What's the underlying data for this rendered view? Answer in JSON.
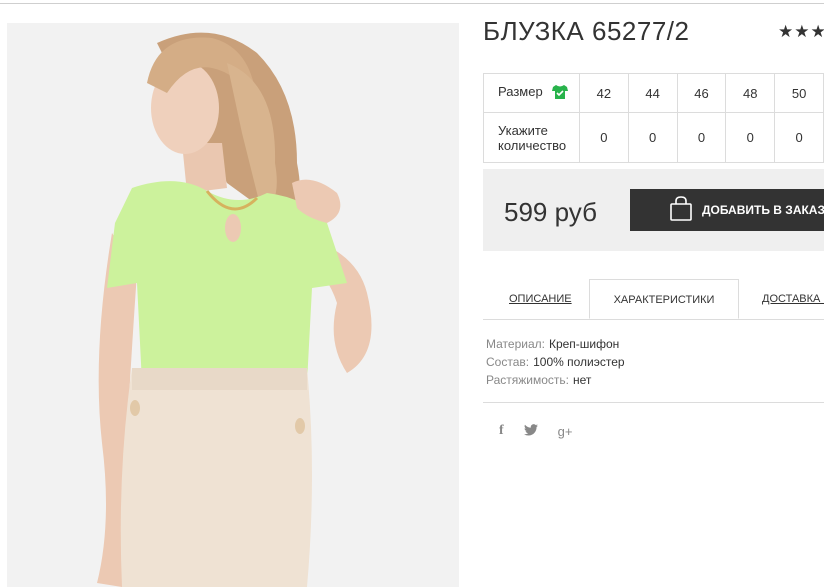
{
  "product": {
    "title": "БЛУЗКА 65277/2",
    "rating_stars": "★★★"
  },
  "sizes": {
    "size_label": "Размер",
    "qty_label_line1": "Укажите",
    "qty_label_line2": "количество",
    "values": [
      "42",
      "44",
      "46",
      "48",
      "50"
    ],
    "quantities": [
      "0",
      "0",
      "0",
      "0",
      "0"
    ]
  },
  "purchase": {
    "price": "599 руб",
    "order_button": "ДОБАВИТЬ В ЗАКАЗ"
  },
  "tabs": {
    "description": "ОПИСАНИЕ",
    "characteristics": "ХАРАКТЕРИСТИКИ",
    "delivery": "ДОСТАВКА И"
  },
  "specs": [
    {
      "key": "Материал:",
      "value": "Креп-шифон"
    },
    {
      "key": "Состав:",
      "value": "100% полиэстер"
    },
    {
      "key": "Растяжимость:",
      "value": "нет"
    }
  ],
  "social": {
    "facebook": "f",
    "twitter_icon": "twitter-icon",
    "googleplus": "g+"
  },
  "colors": {
    "button_bg": "#333333",
    "price_box_bg": "#efefef",
    "accent_green": "#28b34b"
  }
}
